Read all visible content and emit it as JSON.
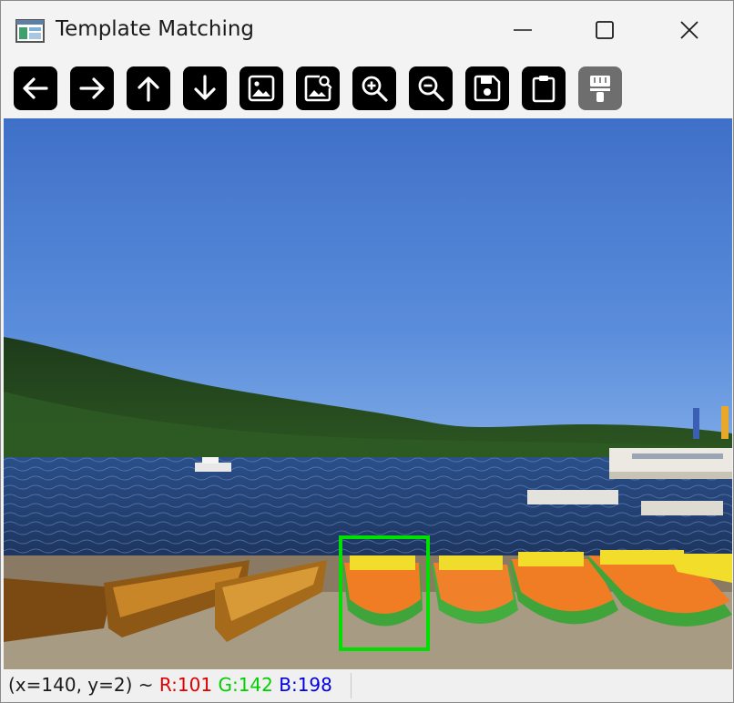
{
  "window": {
    "title": "Template Matching",
    "icon": "app-window-icon",
    "controls": [
      "minimize-icon",
      "maximize-icon",
      "close-icon"
    ]
  },
  "toolbar": {
    "buttons": [
      {
        "icon": "arrow-left-icon",
        "enabled": true
      },
      {
        "icon": "arrow-right-icon",
        "enabled": true
      },
      {
        "icon": "arrow-up-icon",
        "enabled": true
      },
      {
        "icon": "arrow-down-icon",
        "enabled": true
      },
      {
        "icon": "image-icon",
        "enabled": true
      },
      {
        "icon": "image-search-icon",
        "enabled": true
      },
      {
        "icon": "zoom-in-icon",
        "enabled": true
      },
      {
        "icon": "zoom-out-icon",
        "enabled": true
      },
      {
        "icon": "save-icon",
        "enabled": true
      },
      {
        "icon": "clipboard-icon",
        "enabled": true
      },
      {
        "icon": "paint-brush-icon",
        "enabled": false
      }
    ]
  },
  "image": {
    "description_icon": "lake-with-boats-photo",
    "match_box_color": "#00e000"
  },
  "status": {
    "coords": "(x=140, y=2) ~ ",
    "r": "R:101",
    "g": "G:142",
    "b": "B:198",
    "r_color": "#e00000",
    "g_color": "#00d000",
    "b_color": "#0000e0"
  }
}
